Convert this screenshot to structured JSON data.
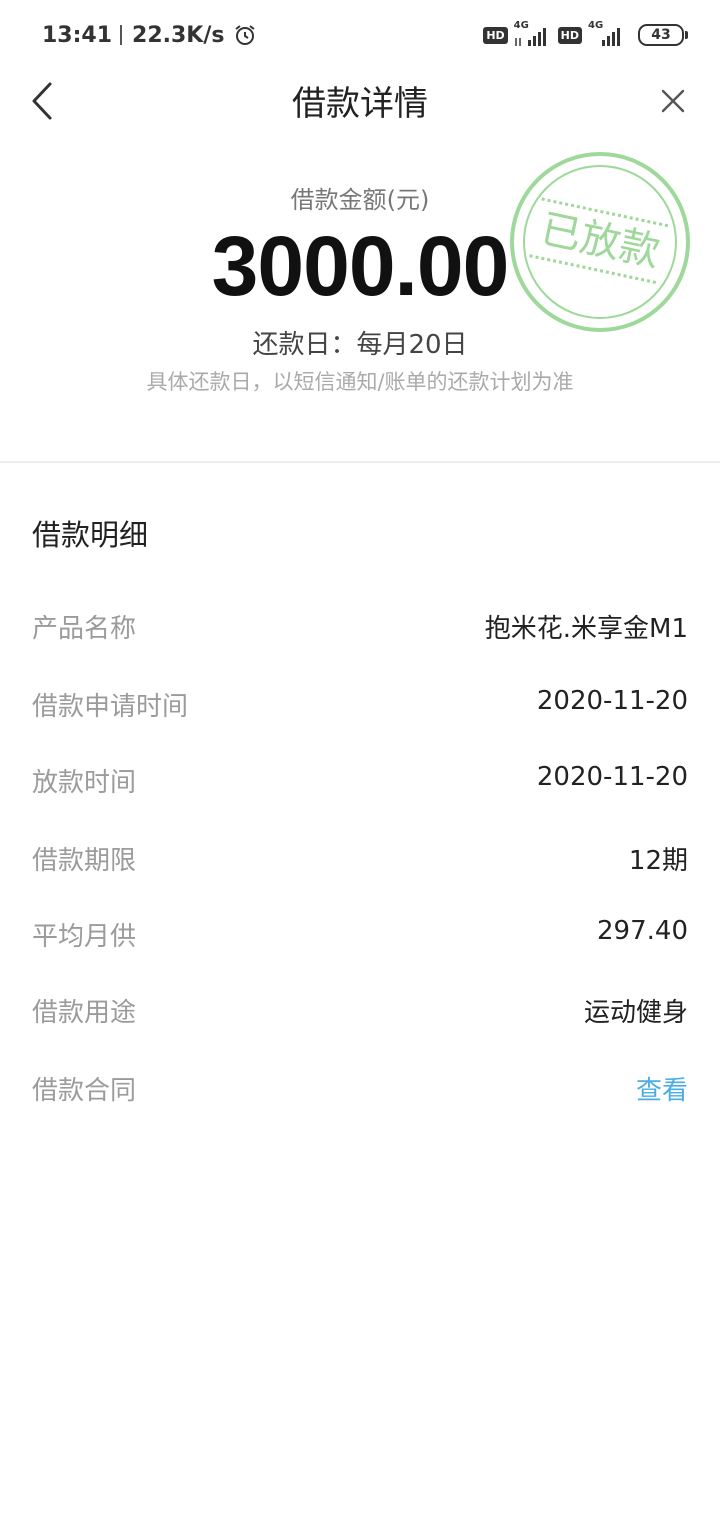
{
  "status_bar": {
    "time": "13:41",
    "speed": "22.3K/s",
    "hd1": "HD",
    "net1": "4G",
    "hd2": "HD",
    "net2": "4G",
    "battery": "43"
  },
  "nav": {
    "title": "借款详情"
  },
  "summary": {
    "amount_label": "借款金额(元)",
    "amount": "3000.00",
    "repay_day": "还款日：每月20日",
    "repay_note": "具体还款日，以短信通知/账单的还款计划为准",
    "stamp_text": "已放款",
    "stamp_color": "#9ed89a"
  },
  "details": {
    "title": "借款明细",
    "rows": [
      {
        "label": "产品名称",
        "value": "抱米花.米享金M1"
      },
      {
        "label": "借款申请时间",
        "value": "2020-11-20"
      },
      {
        "label": "放款时间",
        "value": "2020-11-20"
      },
      {
        "label": "借款期限",
        "value": "12期"
      },
      {
        "label": "平均月供",
        "value": "297.40"
      },
      {
        "label": "借款用途",
        "value": "运动健身"
      },
      {
        "label": "借款合同",
        "value": "查看"
      }
    ],
    "link_color": "#4aaee3"
  }
}
